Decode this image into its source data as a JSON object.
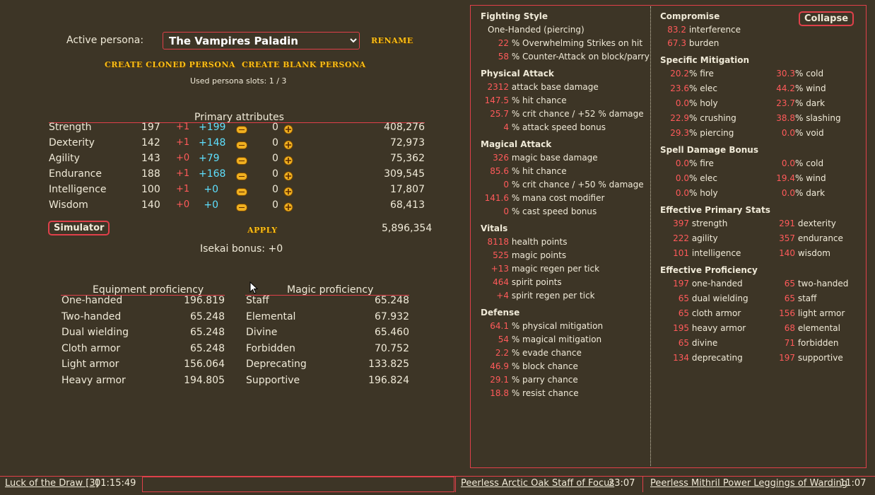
{
  "persona": {
    "label": "Active persona:",
    "selected": "The Vampires Paladin",
    "rename": "RENAME",
    "create_cloned": "CREATE CLONED PERSONA",
    "create_blank": "CREATE BLANK PERSONA",
    "slots": "Used persona slots: 1 / 3"
  },
  "primary": {
    "title": "Primary attributes",
    "rows": [
      {
        "name": "Strength",
        "base": "197",
        "mod": "+1",
        "bonus": "+199",
        "alloc": "0",
        "xp": "408,276"
      },
      {
        "name": "Dexterity",
        "base": "142",
        "mod": "+1",
        "bonus": "+148",
        "alloc": "0",
        "xp": "72,973"
      },
      {
        "name": "Agility",
        "base": "143",
        "mod": "+0",
        "bonus": "+79",
        "alloc": "0",
        "xp": "75,362"
      },
      {
        "name": "Endurance",
        "base": "188",
        "mod": "+1",
        "bonus": "+168",
        "alloc": "0",
        "xp": "309,545"
      },
      {
        "name": "Intelligence",
        "base": "100",
        "mod": "+1",
        "bonus": "+0",
        "alloc": "0",
        "xp": "17,807"
      },
      {
        "name": "Wisdom",
        "base": "140",
        "mod": "+0",
        "bonus": "+0",
        "alloc": "0",
        "xp": "68,413"
      }
    ],
    "simulator": "Simulator",
    "apply": "APPLY",
    "total": "5,896,354",
    "isekai": "Isekai bonus: +0"
  },
  "equipment": {
    "title": "Equipment proficiency",
    "rows": [
      {
        "name": "One-handed",
        "value": "196.819"
      },
      {
        "name": "Two-handed",
        "value": "65.248"
      },
      {
        "name": "Dual wielding",
        "value": "65.248"
      },
      {
        "name": "Cloth armor",
        "value": "65.248"
      },
      {
        "name": "Light armor",
        "value": "156.064"
      },
      {
        "name": "Heavy armor",
        "value": "194.805"
      }
    ]
  },
  "magic": {
    "title": "Magic proficiency",
    "rows": [
      {
        "name": "Staff",
        "value": "65.248"
      },
      {
        "name": "Elemental",
        "value": "67.932"
      },
      {
        "name": "Divine",
        "value": "65.460"
      },
      {
        "name": "Forbidden",
        "value": "70.752"
      },
      {
        "name": "Deprecating",
        "value": "133.825"
      },
      {
        "name": "Supportive",
        "value": "196.824"
      }
    ]
  },
  "stats_left": {
    "fighting": {
      "title": "Fighting Style",
      "style": "One-Handed (piercing)",
      "rows": [
        [
          "22",
          "% Overwhelming Strikes on hit"
        ],
        [
          "58",
          "% Counter-Attack on block/parry"
        ]
      ]
    },
    "physical": {
      "title": "Physical Attack",
      "rows": [
        [
          "2312",
          "attack base damage"
        ],
        [
          "147.5",
          "% hit chance"
        ],
        [
          "25.7",
          "% crit chance / +52 % damage"
        ],
        [
          "4",
          "% attack speed bonus"
        ]
      ]
    },
    "magical": {
      "title": "Magical Attack",
      "rows": [
        [
          "326",
          "magic base damage"
        ],
        [
          "85.6",
          "% hit chance"
        ],
        [
          "0",
          "% crit chance / +50 % damage"
        ],
        [
          "141.6",
          "% mana cost modifier"
        ],
        [
          "0",
          "% cast speed bonus"
        ]
      ]
    },
    "vitals": {
      "title": "Vitals",
      "rows": [
        [
          "8118",
          "health points"
        ],
        [
          "525",
          "magic points"
        ],
        [
          "+13",
          "magic regen per tick"
        ],
        [
          "464",
          "spirit points"
        ],
        [
          "+4",
          "spirit regen per tick"
        ]
      ]
    },
    "defense": {
      "title": "Defense",
      "rows": [
        [
          "64.1",
          "% physical mitigation"
        ],
        [
          "54",
          "% magical mitigation"
        ],
        [
          "2.2",
          "% evade chance"
        ],
        [
          "46.9",
          "% block chance"
        ],
        [
          "29.1",
          "% parry chance"
        ],
        [
          "18.8",
          "% resist chance"
        ]
      ]
    }
  },
  "stats_right": {
    "collapse": "Collapse",
    "compromise": {
      "title": "Compromise",
      "rows": [
        [
          "83.2",
          "interference"
        ],
        [
          "67.3",
          "burden"
        ]
      ]
    },
    "mitigation": {
      "title": "Specific Mitigation",
      "rows": [
        [
          "20.2",
          "% fire",
          "30.3",
          "% cold"
        ],
        [
          "23.6",
          "% elec",
          "44.2",
          "% wind"
        ],
        [
          "0.0",
          "% holy",
          "23.7",
          "% dark"
        ],
        [
          "22.9",
          "% crushing",
          "38.8",
          "% slashing"
        ],
        [
          "29.3",
          "% piercing",
          "0.0",
          "% void"
        ]
      ]
    },
    "spell": {
      "title": "Spell Damage Bonus",
      "rows": [
        [
          "0.0",
          "% fire",
          "0.0",
          "% cold"
        ],
        [
          "0.0",
          "% elec",
          "19.4",
          "% wind"
        ],
        [
          "0.0",
          "% holy",
          "0.0",
          "% dark"
        ]
      ]
    },
    "effective_stats": {
      "title": "Effective Primary Stats",
      "rows": [
        [
          "397",
          "strength",
          "291",
          "dexterity"
        ],
        [
          "222",
          "agility",
          "357",
          "endurance"
        ],
        [
          "101",
          "intelligence",
          "140",
          "wisdom"
        ]
      ]
    },
    "effective_prof": {
      "title": "Effective Proficiency",
      "rows": [
        [
          "197",
          "one-handed",
          "65",
          "two-handed"
        ],
        [
          "65",
          "dual wielding",
          "65",
          "staff"
        ],
        [
          "65",
          "cloth armor",
          "156",
          "light armor"
        ],
        [
          "195",
          "heavy armor",
          "68",
          "elemental"
        ],
        [
          "65",
          "divine",
          "71",
          "forbidden"
        ],
        [
          "134",
          "deprecating",
          "197",
          "supportive"
        ]
      ]
    }
  },
  "bottom": {
    "effect_name": "Luck of the Draw [3]",
    "effect_time": "01:15:49",
    "item1_name": "Peerless Arctic Oak Staff of Focus",
    "item1_time": "23:07",
    "item2_name": "Peerless Mithril Power Leggings of Warding",
    "item2_time": "11:07"
  }
}
